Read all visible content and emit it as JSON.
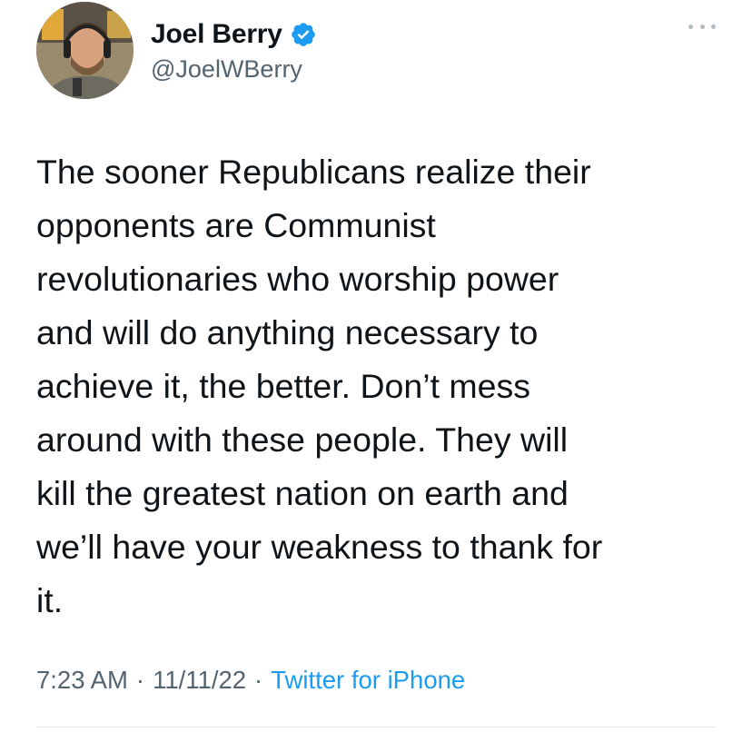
{
  "author": {
    "display_name": "Joel Berry",
    "handle": "@JoelWBerry",
    "verified": true,
    "avatar_icon": "profile-photo"
  },
  "tweet": {
    "text": "The sooner Republicans realize their\nopponents are Communist\nrevolutionaries who worship power\nand will do anything necessary to\nachieve it, the better. Don’t mess\naround with these people. They will\nkill the greatest nation on earth and\nwe’ll have your weakness to thank for\nit.",
    "time": "7:23 AM",
    "date": "11/11/22",
    "separator": "·",
    "source": "Twitter for iPhone"
  },
  "colors": {
    "text": "#0f1419",
    "secondary": "#536471",
    "link": "#1d9bf0",
    "verified": "#1d9bf0"
  }
}
